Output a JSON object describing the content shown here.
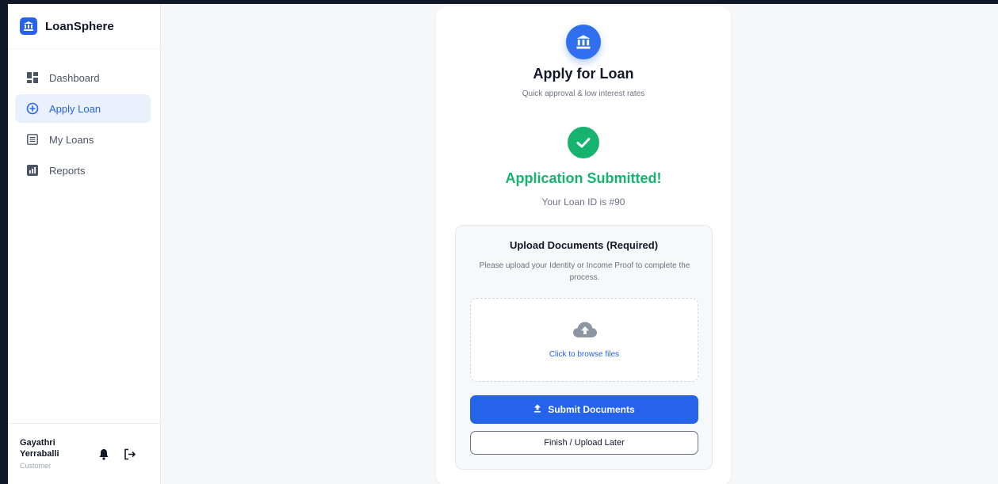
{
  "app": {
    "name": "LoanSphere",
    "logo_icon": "bank-icon",
    "accent_color": "#2563eb"
  },
  "sidebar": {
    "items": [
      {
        "label": "Dashboard",
        "icon": "dashboard-grid-icon",
        "active": false
      },
      {
        "label": "Apply Loan",
        "icon": "plus-circle-icon",
        "active": true
      },
      {
        "label": "My Loans",
        "icon": "list-icon",
        "active": false
      },
      {
        "label": "Reports",
        "icon": "bar-chart-icon",
        "active": false
      }
    ]
  },
  "user": {
    "name": "Gayathri Yerraballi",
    "role": "Customer",
    "actions": [
      "bell-icon",
      "logout-icon"
    ]
  },
  "card": {
    "title": "Apply for Loan",
    "subtitle": "Quick approval & low interest rates",
    "success_title": "Application Submitted!",
    "loan_id_text": "Your Loan ID is #90",
    "success_color": "#16b36e"
  },
  "upload": {
    "title": "Upload Documents (Required)",
    "description": "Please upload your Identity or Income Proof to complete the process.",
    "dropzone_text": "Click to browse files",
    "submit_label": "Submit Documents",
    "finish_label": "Finish / Upload Later"
  }
}
